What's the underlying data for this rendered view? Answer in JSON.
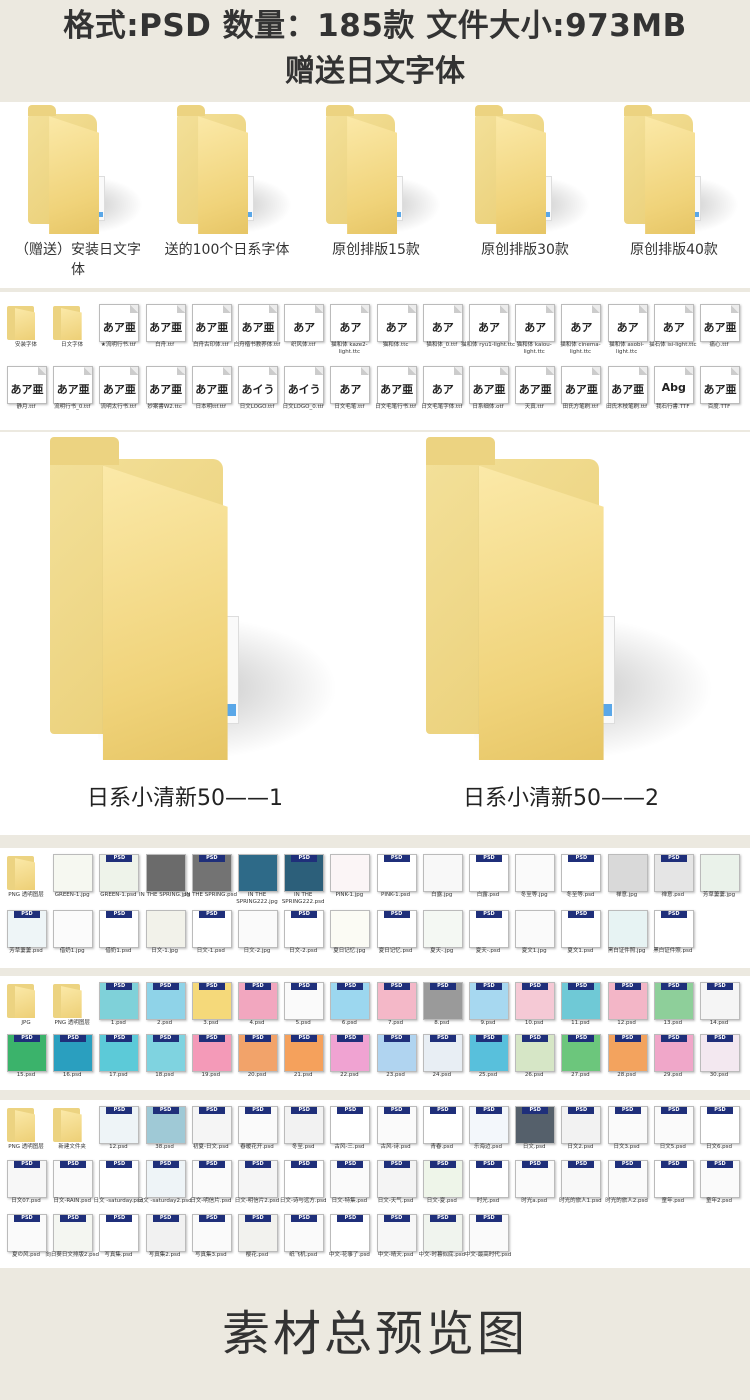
{
  "header": {
    "line1": "格式:PSD 数量：185款 文件大小:973MB",
    "line2": "赠送日文字体"
  },
  "top_folders": [
    {
      "label": "（赠送）安装日文字体"
    },
    {
      "label": "送的100个日系字体"
    },
    {
      "label": "原创排版15款"
    },
    {
      "label": "原创排版30款"
    },
    {
      "label": "原创排版40款"
    }
  ],
  "font_files": {
    "row1": [
      {
        "name": "安装字体",
        "type": "folder"
      },
      {
        "name": "日文字体",
        "type": "folder"
      },
      {
        "name": "★流明行书.ttf",
        "glyph": "あア亜"
      },
      {
        "name": "白舟.ttf",
        "glyph": "あア亜"
      },
      {
        "name": "白舟古印体.ttf",
        "glyph": "あア亜"
      },
      {
        "name": "白舟楷书教养体.ttf",
        "glyph": "あア亜"
      },
      {
        "name": "织风体.ttf",
        "glyph": "あア"
      },
      {
        "name": "猫和体 kaze2-light.ttc",
        "glyph": "あア"
      },
      {
        "name": "猫和体.ttc",
        "glyph": "あア"
      },
      {
        "name": "猫和体_0.ttf",
        "glyph": "あア"
      },
      {
        "name": "猫和体 ryu1-light.ttc",
        "glyph": "あア"
      },
      {
        "name": "猫和体 kaiou-light.ttc",
        "glyph": "あア"
      },
      {
        "name": "猫和体 cinema-light.ttc",
        "glyph": "あア"
      },
      {
        "name": "猫和体 asobi-light.ttc",
        "glyph": "あア"
      },
      {
        "name": "猫石体 isi-light.ttc",
        "glyph": "あア"
      },
      {
        "name": "痛心.ttf",
        "glyph": "あア亜"
      }
    ],
    "row2": [
      {
        "name": "静月.ttf",
        "glyph": "あア亜"
      },
      {
        "name": "流明行书_0.ttf",
        "glyph": "あア亜"
      },
      {
        "name": "流明太行书.ttf",
        "glyph": "あア亜"
      },
      {
        "name": "妙案書W2.ttc",
        "glyph": "あア亜"
      },
      {
        "name": "日本明ttf.ttf",
        "glyph": "あア亜"
      },
      {
        "name": "日文LOGO.ttf",
        "glyph": "あイう"
      },
      {
        "name": "日文LOGO_0.ttf",
        "glyph": "あイう"
      },
      {
        "name": "日文毛笔.ttf",
        "glyph": "あア"
      },
      {
        "name": "日文毛笔行书.ttf",
        "glyph": "あア亜"
      },
      {
        "name": "日文毛笔字体.ttf",
        "glyph": "あア"
      },
      {
        "name": "日系细体.otf",
        "glyph": "あア亜"
      },
      {
        "name": "天真.ttf",
        "glyph": "あア亜"
      },
      {
        "name": "田氏方笔刷.ttf",
        "glyph": "あア亜"
      },
      {
        "name": "田氏木枝笔刷.ttf",
        "glyph": "あア亜"
      },
      {
        "name": "我石行書.TTF",
        "glyph": "Abg"
      },
      {
        "name": "百度.TTF",
        "glyph": "あア亜"
      }
    ]
  },
  "big_folders": [
    {
      "label": "日系小清新50——1"
    },
    {
      "label": "日系小清新50——2"
    }
  ],
  "psd_tag": "PSD",
  "set1": {
    "row1": [
      "PNG 透明图层",
      "GREEN-1.jpg",
      "GREEN-1.psd",
      "IN THE SPRING.jpg",
      "IN THE SPRING.psd",
      "IN THE SPRING222.jpg",
      "IN THE SPRING222.psd",
      "PINK-1.jpg",
      "PINK-1.psd",
      "白露.jpg",
      "白露.psd",
      "冬至等.jpg",
      "冬至等.psd",
      "禅意.jpg",
      "禅意.psd",
      "芳草萋萋.jpg"
    ],
    "row2": [
      "芳草萋萋.psd",
      "借奶1.jpg",
      "借奶1.psd",
      "日文-1.jpg",
      "日文-1.psd",
      "日文-2.jpg",
      "日文-2.psd",
      "夏日记忆.jpg",
      "夏日记忆.psd",
      "夏天-.jpg",
      "夏天-.psd",
      "夏文1.jpg",
      "夏文1.psd",
      "黑白证件照.jpg",
      "黑白证件照.psd"
    ]
  },
  "set2": {
    "row1": [
      "JPG",
      "PNG 透明图层",
      "1.psd",
      "2.psd",
      "3.psd",
      "4.psd",
      "5.psd",
      "6.psd",
      "7.psd",
      "8.psd",
      "9.psd",
      "10.psd",
      "11.psd",
      "12.psd",
      "13.psd",
      "14.psd"
    ],
    "row2": [
      "15.psd",
      "16.psd",
      "17.psd",
      "18.psd",
      "19.psd",
      "20.psd",
      "21.psd",
      "22.psd",
      "23.psd",
      "24.psd",
      "25.psd",
      "26.psd",
      "27.psd",
      "28.psd",
      "29.psd",
      "30.psd"
    ]
  },
  "set3": {
    "row1": [
      "PNG 透明图层",
      "新建文件夹",
      "12.psd",
      "38.psd",
      "初夏-日文.psd",
      "春暖花开.psd",
      "冬至.psd",
      "古风-三.psd",
      "古风-诗.psd",
      "青春.psd",
      "乐海边.psd",
      "日文.psd",
      "日文2.psd",
      "日文3.psd",
      "日文5.psd",
      "日文6.psd"
    ],
    "row2": [
      "日文07.psd",
      "日文-RAIN.psd",
      "日文 -saturday.psd",
      "日文 -saturday2.psd",
      "日文-明信片.psd",
      "日文-明信片2.psd",
      "日文-诗与远方.psd",
      "日文-特集.psd",
      "日文-天气.psd",
      "日文-夏.psd",
      "时光.psd",
      "时光a.psd",
      "时光的旅人1.psd",
      "时光的旅人2.psd",
      "童年.psd",
      "童年2.psd"
    ],
    "row3": [
      "夏の风.psd",
      "向日葵日文排版2.psd",
      "写真集.psd",
      "写真集2.psd",
      "写真集3.psd",
      "樱花.psd",
      "纸飞机.psd",
      "中文-花事了.psd",
      "中文-晴天.psd",
      "中文-时暮似底.psd",
      "中文-最高时代.psd"
    ]
  },
  "footer": {
    "title": "素材总预览图"
  }
}
